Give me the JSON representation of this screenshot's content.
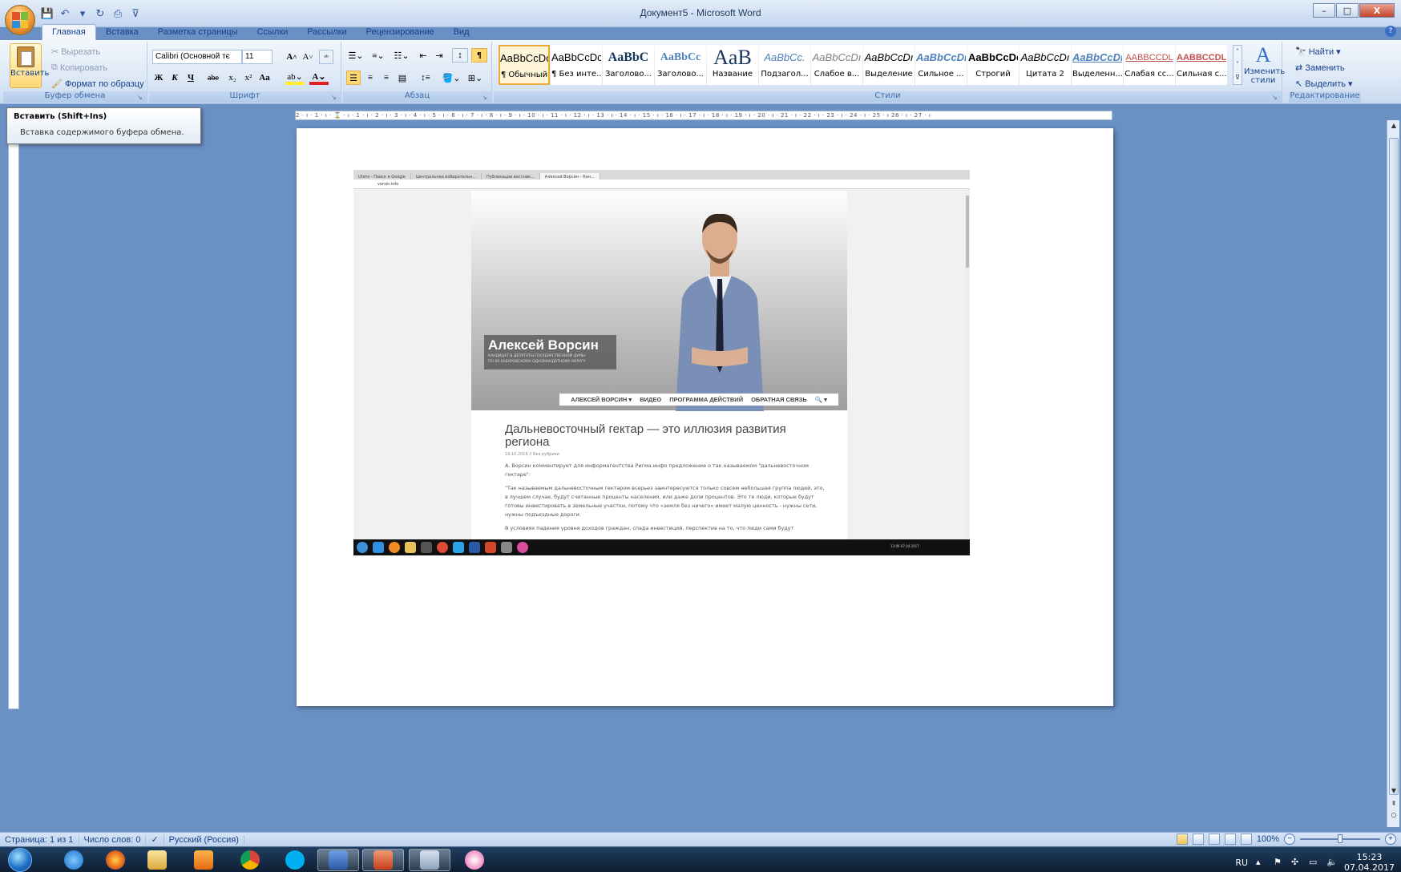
{
  "window": {
    "title": "Документ5 - Microsoft Word",
    "controls": [
      "–",
      "□",
      "X"
    ]
  },
  "colors": {
    "accent": "#15428b",
    "ribbon_bg": "#dde8f6",
    "workspace": "#6b90c4",
    "selected_style": "#f0a837"
  },
  "tabs": [
    {
      "label": "Главная",
      "active": true
    },
    {
      "label": "Вставка"
    },
    {
      "label": "Разметка страницы"
    },
    {
      "label": "Ссылки"
    },
    {
      "label": "Рассылки"
    },
    {
      "label": "Рецензирование"
    },
    {
      "label": "Вид"
    }
  ],
  "clipboard": {
    "paste_label": "Вставить",
    "cut": "Вырезать",
    "copy": "Копировать",
    "format_painter": "Формат по образцу",
    "group_label": "Буфер обмена"
  },
  "font": {
    "family": "Calibri (Основной тє",
    "size": "11",
    "group_label": "Шрифт",
    "bold": "Ж",
    "italic": "К",
    "underline": "Ч",
    "strike": "abe",
    "sub": "x₂",
    "sup": "x²",
    "case": "Aa"
  },
  "paragraph": {
    "group_label": "Абзац"
  },
  "styles": {
    "group_label": "Стили",
    "items": [
      {
        "preview": "AaBbCcDc",
        "name": "¶ Обычный"
      },
      {
        "preview": "AaBbCcDc",
        "name": "¶ Без инте..."
      },
      {
        "preview": "AaBbC",
        "name": "Заголово..."
      },
      {
        "preview": "AaBbCc",
        "name": "Заголово..."
      },
      {
        "preview": "AaB",
        "name": "Название"
      },
      {
        "preview": "AaBbCc.",
        "name": "Подзагол..."
      },
      {
        "preview": "AaBbCcDı",
        "name": "Слабое в..."
      },
      {
        "preview": "AaBbCcDı",
        "name": "Выделение"
      },
      {
        "preview": "AaBbCcDı",
        "name": "Сильное ..."
      },
      {
        "preview": "AaBbCcDc",
        "name": "Строгий"
      },
      {
        "preview": "AaBbCcDı",
        "name": "Цитата 2"
      },
      {
        "preview": "AaBbCcDı",
        "name": "Выделенн..."
      },
      {
        "preview": "AABBCCDL",
        "name": "Слабая сс..."
      },
      {
        "preview": "AABBCCDL",
        "name": "Сильная с..."
      }
    ],
    "change_styles_1": "Изменить",
    "change_styles_2": "стили"
  },
  "editing": {
    "group_label": "Редактирование",
    "find": "Найти",
    "replace": "Заменить",
    "select": "Выделить"
  },
  "tooltip": {
    "title": "Вставить (Shift+Ins)",
    "text": "Вставка содержимого буфера обмена."
  },
  "ruler": {
    "text": "2 · ı · 1 · ı · ⌛ · ı · 1 · ı · 2 · ı · 3 · ı · 4 · ı · 5 · ı · 6 · ı · 7 · ı · 8 · ı · 9 · ı · 10 · ı · 11 · ı · 12 · ı · 13 · ı · 14 · ı · 15 · ı · 16 · ı · 17 · ı · 18 · ı · 19 · ı · 20 · ı · 21 · ı · 22 · ı · 23 · ı · 24 · ı · 25 · ı 26 · ı · 27 · ı"
  },
  "embedded_screenshot": {
    "browser_tabs": [
      "Ufahs - Поиск в Google",
      "Центральная избирательн...",
      "Публикации вестник...",
      "Алексей Ворсин - Кан..."
    ],
    "address": "vorsin.info",
    "hero_name": "Алексей Ворсин",
    "hero_sub_1": "КАНДИДАТ В ДЕПУТАТЫ ГОСУДАРСТВЕННОЙ ДУМЫ",
    "hero_sub_2": "ПО 69 ХАБАРОВСКОМУ ОДНОМАНДАТНОМУ ОКРУГУ",
    "nav": [
      "АЛЕКСЕЙ ВОРСИН ▾",
      "ВИДЕО",
      "ПРОГРАММА ДЕЙСТВИЙ",
      "ОБРАТНАЯ СВЯЗЬ",
      "🔍 ▾"
    ],
    "article_title": "Дальневосточный гектар — это иллюзия развития региона",
    "article_date": "19.10.2016 // Без рубрики",
    "p1": "А. Ворсин комментирует для информагентства Ригма.инфо предложение о так называемом \"дальневосточном гектаре\":",
    "p2": "\"Так называемым дальневосточным гектаром всерьез заинтересуются только совсем небольшая группа людей, это, в лучшем случае, будут считанные проценты населения, или даже доли процентов. Это те люди, которые будут готовы инвестировать в земельные участки, потому что «земля без ничего» имеет малую ценность - нужны сети, нужны подъездные дороги.",
    "p3": "В условиях падения уровня доходов граждан, спада инвестиций, перспектив на то, что люди сами будут",
    "tray_time": "13:06",
    "tray_date": "07.04.2017"
  },
  "statusbar": {
    "page": "Страница: 1 из 1",
    "words": "Число слов: 0",
    "language": "Русский (Россия)",
    "zoom": "100%",
    "zoom_level": 0.5
  },
  "taskbar": {
    "apps": [
      "ie",
      "firefox",
      "explorer",
      "media-player",
      "chrome",
      "skype",
      "word",
      "powerpoint",
      "paint",
      "itunes"
    ],
    "lang": "RU",
    "time": "15:23",
    "date": "07.04.2017"
  }
}
